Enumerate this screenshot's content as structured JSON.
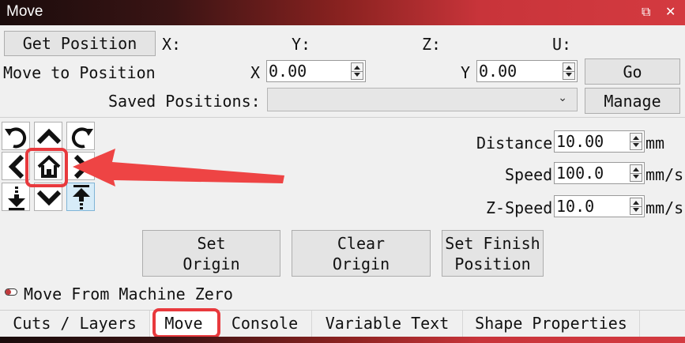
{
  "window": {
    "title": "Move",
    "restore_glyph": "⧉",
    "close_glyph": "✕"
  },
  "position": {
    "get_button": "Get Position",
    "x_label": "X:",
    "y_label": "Y:",
    "z_label": "Z:",
    "u_label": "U:"
  },
  "move_to": {
    "label": "Move to Position",
    "x_label": "X",
    "x_value": "0.00",
    "y_label": "Y",
    "y_value": "0.00",
    "go_button": "Go"
  },
  "saved": {
    "label": "Saved Positions:",
    "value": "",
    "manage_button": "Manage"
  },
  "jog": {
    "icons": [
      "rotate-ccw-icon",
      "arrow-up-icon",
      "rotate-cw-icon",
      "arrow-left-icon",
      "home-icon",
      "arrow-right-icon",
      "z-down-icon",
      "arrow-down-icon",
      "z-up-icon"
    ]
  },
  "params": {
    "distance_label": "Distance",
    "distance_value": "10.00",
    "distance_unit": "mm",
    "speed_label": "Speed",
    "speed_value": "100.0",
    "speed_unit": "mm/s",
    "zspeed_label": "Z-Speed",
    "zspeed_value": "10.0",
    "zspeed_unit": "mm/s"
  },
  "actions": {
    "set_origin": "Set\nOrigin",
    "clear_origin": "Clear\nOrigin",
    "set_finish": "Set Finish\nPosition"
  },
  "toggle": {
    "label": "Move From Machine Zero"
  },
  "tabs": [
    {
      "label": "Cuts / Layers"
    },
    {
      "label": "Move"
    },
    {
      "label": "Console"
    },
    {
      "label": "Variable Text"
    },
    {
      "label": "Shape Properties"
    }
  ],
  "colors": {
    "annotation": "#e8393d",
    "titlebar_end": "#d43a40"
  }
}
